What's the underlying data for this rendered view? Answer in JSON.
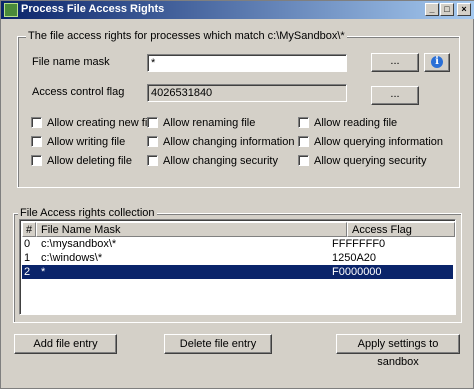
{
  "window": {
    "title": "Process File Access Rights",
    "controls": {
      "minimize": "_",
      "maximize": "□",
      "close": "×"
    }
  },
  "settings_group": {
    "legend": "The file access rights for processes which match c:\\MySandbox\\*",
    "file_name_mask_label": "File name mask",
    "file_name_mask_value": "*",
    "browse_mask_label": "...",
    "info_icon": "i",
    "access_flag_label": "Access control flag",
    "access_flag_value": "4026531840",
    "browse_flag_label": "...",
    "checkboxes": [
      {
        "label": "Allow creating new file",
        "checked": false
      },
      {
        "label": "Allow renaming file",
        "checked": false
      },
      {
        "label": "Allow reading file",
        "checked": false
      },
      {
        "label": "Allow writing file",
        "checked": false
      },
      {
        "label": "Allow changing information",
        "checked": false
      },
      {
        "label": "Allow querying information",
        "checked": false
      },
      {
        "label": "Allow deleting file",
        "checked": false
      },
      {
        "label": "Allow changing security",
        "checked": false
      },
      {
        "label": "Allow querying security",
        "checked": false
      }
    ]
  },
  "collection_group": {
    "legend": "File Access rights collection",
    "columns": [
      "#",
      "File Name Mask",
      "Access Flag"
    ],
    "rows": [
      {
        "index": "0",
        "mask": "c:\\mysandbox\\*",
        "flag": "FFFFFFF0",
        "selected": false
      },
      {
        "index": "1",
        "mask": "c:\\windows\\*",
        "flag": "1250A20",
        "selected": false
      },
      {
        "index": "2",
        "mask": "*",
        "flag": "F0000000",
        "selected": true
      }
    ]
  },
  "buttons": {
    "add": "Add file entry",
    "delete": "Delete file entry",
    "apply": "Apply settings to sandbox"
  }
}
